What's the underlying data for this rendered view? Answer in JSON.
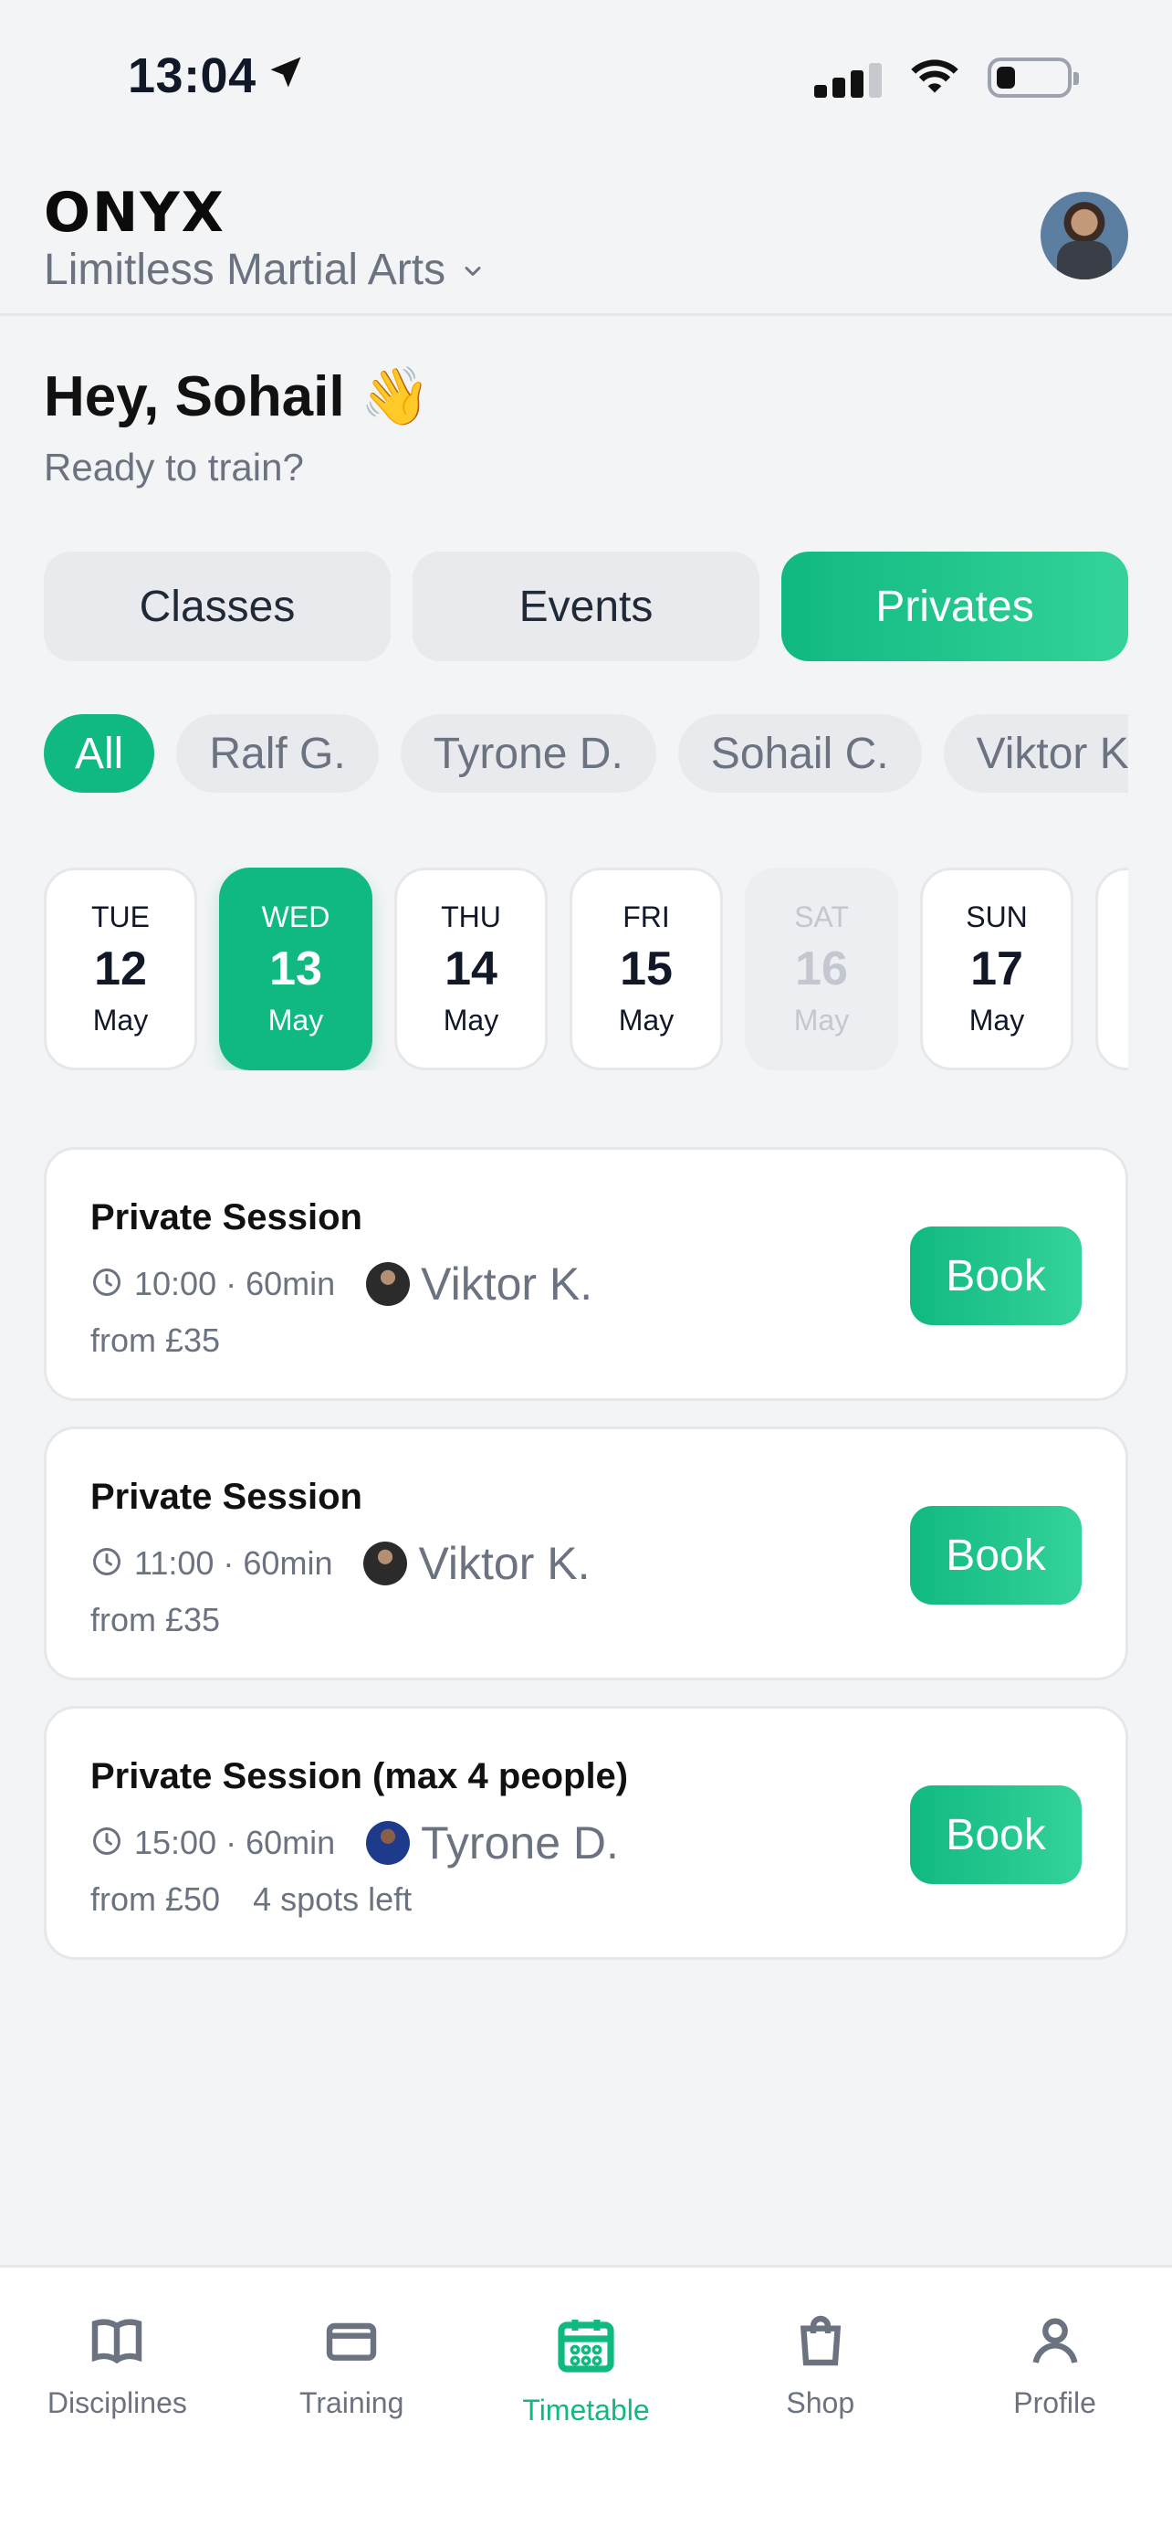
{
  "status": {
    "time": "13:04"
  },
  "header": {
    "logo": "ONYX",
    "gym_name": "Limitless Martial Arts"
  },
  "greeting": {
    "title": "Hey, Sohail 👋",
    "subtitle": "Ready to train?"
  },
  "tabs": [
    {
      "label": "Classes"
    },
    {
      "label": "Events"
    },
    {
      "label": "Privates",
      "active": true
    }
  ],
  "filters": [
    {
      "label": "All",
      "active": true
    },
    {
      "label": "Ralf G."
    },
    {
      "label": "Tyrone D."
    },
    {
      "label": "Sohail C."
    },
    {
      "label": "Viktor K."
    }
  ],
  "dates": [
    {
      "dow": "TUE",
      "day": "12",
      "mon": "May"
    },
    {
      "dow": "WED",
      "day": "13",
      "mon": "May",
      "active": true
    },
    {
      "dow": "THU",
      "day": "14",
      "mon": "May"
    },
    {
      "dow": "FRI",
      "day": "15",
      "mon": "May"
    },
    {
      "dow": "SAT",
      "day": "16",
      "mon": "May",
      "disabled": true
    },
    {
      "dow": "SUN",
      "day": "17",
      "mon": "May"
    },
    {
      "dow": "",
      "day": "",
      "mon": ""
    }
  ],
  "sessions": [
    {
      "title": "Private Session",
      "time": "10:00 · 60min",
      "coach": "Viktor K.",
      "price": "from £35",
      "spots": "",
      "book": "Book"
    },
    {
      "title": "Private Session",
      "time": "11:00 · 60min",
      "coach": "Viktor K.",
      "price": "from £35",
      "spots": "",
      "book": "Book"
    },
    {
      "title": "Private Session (max 4 people)",
      "time": "15:00 · 60min",
      "coach": "Tyrone D.",
      "price": "from £50",
      "spots": "4 spots left",
      "book": "Book"
    }
  ],
  "nav": [
    {
      "label": "Disciplines",
      "icon": "book-icon"
    },
    {
      "label": "Training",
      "icon": "card-icon"
    },
    {
      "label": "Timetable",
      "icon": "calendar-icon",
      "active": true
    },
    {
      "label": "Shop",
      "icon": "bag-icon"
    },
    {
      "label": "Profile",
      "icon": "user-icon"
    }
  ],
  "colors": {
    "accent": "#10b981",
    "accent_light": "#34d399",
    "muted": "#6b7280"
  }
}
